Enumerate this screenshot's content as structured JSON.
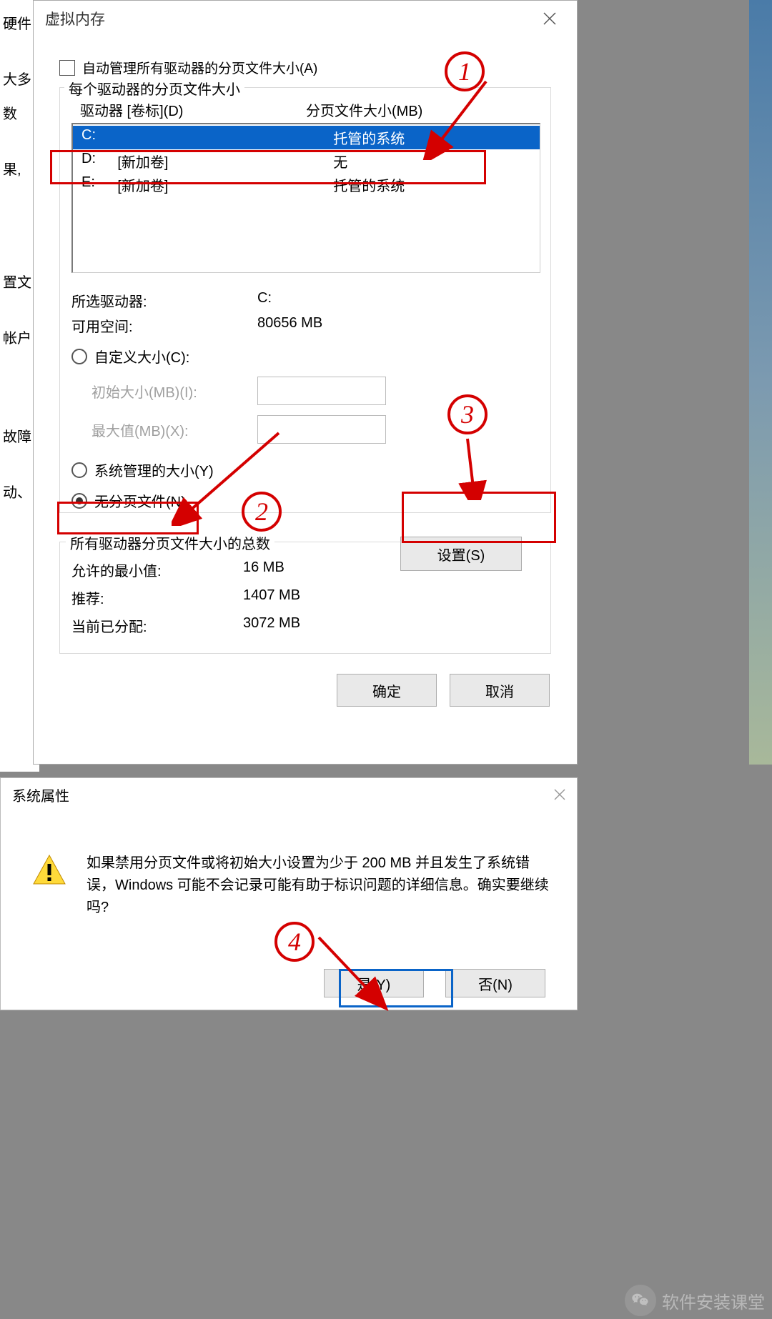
{
  "bg_words": [
    "硬件",
    "大多数",
    "果,",
    "置文",
    "帐户",
    "故障",
    "动、"
  ],
  "vm": {
    "title": "虚拟内存",
    "auto_manage": "自动管理所有驱动器的分页文件大小(A)",
    "per_drive_label": "每个驱动器的分页文件大小",
    "col_drive": "驱动器 [卷标](D)",
    "col_size": "分页文件大小(MB)",
    "rows": [
      {
        "drive": "C:",
        "label": "",
        "size": "托管的系统",
        "sel": true
      },
      {
        "drive": "D:",
        "label": "[新加卷]",
        "size": "无",
        "sel": false
      },
      {
        "drive": "E:",
        "label": "[新加卷]",
        "size": "托管的系统",
        "sel": false
      }
    ],
    "sel_drive_lbl": "所选驱动器:",
    "sel_drive_val": "C:",
    "free_lbl": "可用空间:",
    "free_val": "80656 MB",
    "custom_radio": "自定义大小(C):",
    "init_lbl": "初始大小(MB)(I):",
    "max_lbl": "最大值(MB)(X):",
    "sys_radio": "系统管理的大小(Y)",
    "none_radio": "无分页文件(N)",
    "set_btn": "设置(S)",
    "totals_label": "所有驱动器分页文件大小的总数",
    "min_lbl": "允许的最小值:",
    "min_val": "16 MB",
    "rec_lbl": "推荐:",
    "rec_val": "1407 MB",
    "cur_lbl": "当前已分配:",
    "cur_val": "3072 MB",
    "ok": "确定",
    "cancel": "取消"
  },
  "confirm": {
    "title": "系统属性",
    "text": "如果禁用分页文件或将初始大小设置为少于 200 MB 并且发生了系统错误，Windows 可能不会记录可能有助于标识问题的详细信息。确实要继续吗?",
    "yes": "是(Y)",
    "no": "否(N)"
  },
  "marks": {
    "n1": "1",
    "n2": "2",
    "n3": "3",
    "n4": "4"
  },
  "wm": "软件安装课堂"
}
